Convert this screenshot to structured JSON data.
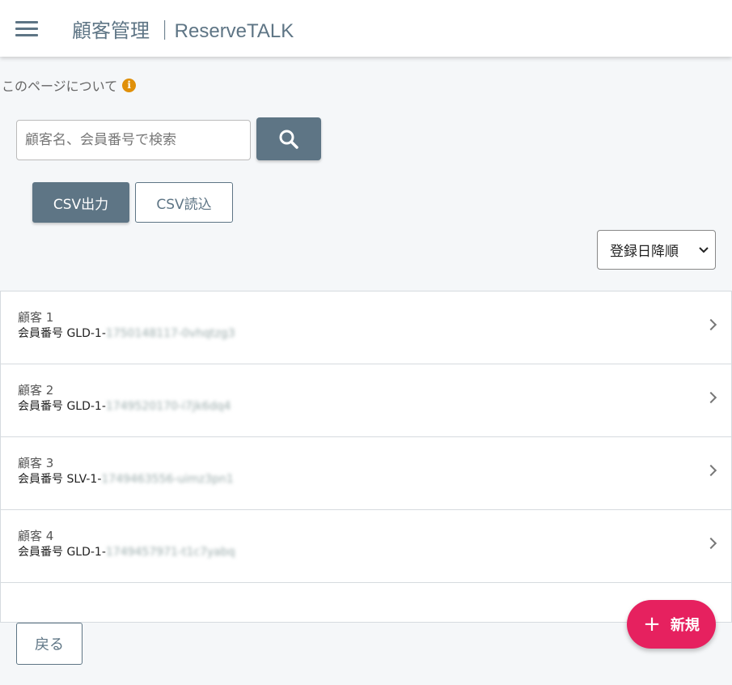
{
  "header": {
    "title": "顧客管理 ｜ReserveTALK"
  },
  "about": {
    "label": "このページについて",
    "icon": "info-icon"
  },
  "search": {
    "placeholder": "顧客名、会員番号で検索",
    "value": ""
  },
  "actions": {
    "csv_export": "CSV出力",
    "csv_import": "CSV読込"
  },
  "sort": {
    "selected": "登録日降順"
  },
  "customers": [
    {
      "name": "顧客 1",
      "member_prefix": "会員番号 GLD-1-",
      "member_rest": "1750148117-0vhqtzg3"
    },
    {
      "name": "顧客 2",
      "member_prefix": "会員番号 GLD-1-",
      "member_rest": "1749520170-i7jk6dq4"
    },
    {
      "name": "顧客 3",
      "member_prefix": "会員番号 SLV-1-",
      "member_rest": "1749463556-uimz3pn1"
    },
    {
      "name": "顧客 4",
      "member_prefix": "会員番号 GLD-1-",
      "member_rest": "1749457971-t1c7yabq"
    }
  ],
  "footer": {
    "back": "戻る",
    "new": "新規"
  },
  "colors": {
    "primary": "#5e7585",
    "accent": "#e6215f",
    "info": "#e0900a"
  }
}
